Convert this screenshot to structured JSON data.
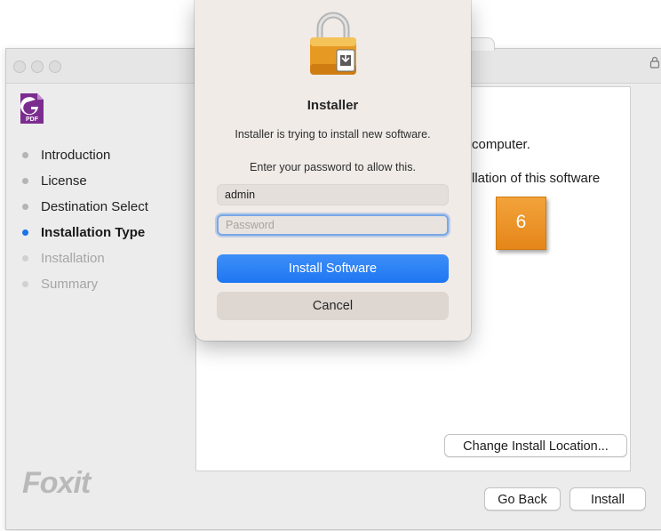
{
  "window": {
    "lock_glyph": "🔒"
  },
  "sidebar": {
    "steps": [
      {
        "label": "Introduction",
        "state": "done"
      },
      {
        "label": "License",
        "state": "done"
      },
      {
        "label": "Destination Select",
        "state": "done"
      },
      {
        "label": "Installation Type",
        "state": "current"
      },
      {
        "label": "Installation",
        "state": "pending"
      },
      {
        "label": "Summary",
        "state": "pending"
      }
    ],
    "brand": "Foxit"
  },
  "content": {
    "line1": "computer.",
    "line2": "llation of this software",
    "change_location_label": "Change Install Location..."
  },
  "footer": {
    "go_back_label": "Go Back",
    "install_label": "Install"
  },
  "badge": {
    "number": "6"
  },
  "dialog": {
    "title": "Installer",
    "message": "Installer is trying to install new software.",
    "prompt": "Enter your password to allow this.",
    "username_value": "admin",
    "password_placeholder": "Password",
    "install_button_label": "Install Software",
    "cancel_button_label": "Cancel"
  },
  "app_icon": {
    "caption": "PDF"
  },
  "colors": {
    "accent": "#1f76f2",
    "current_step_dot": "#1a73e8",
    "badge": "#e5861a"
  }
}
